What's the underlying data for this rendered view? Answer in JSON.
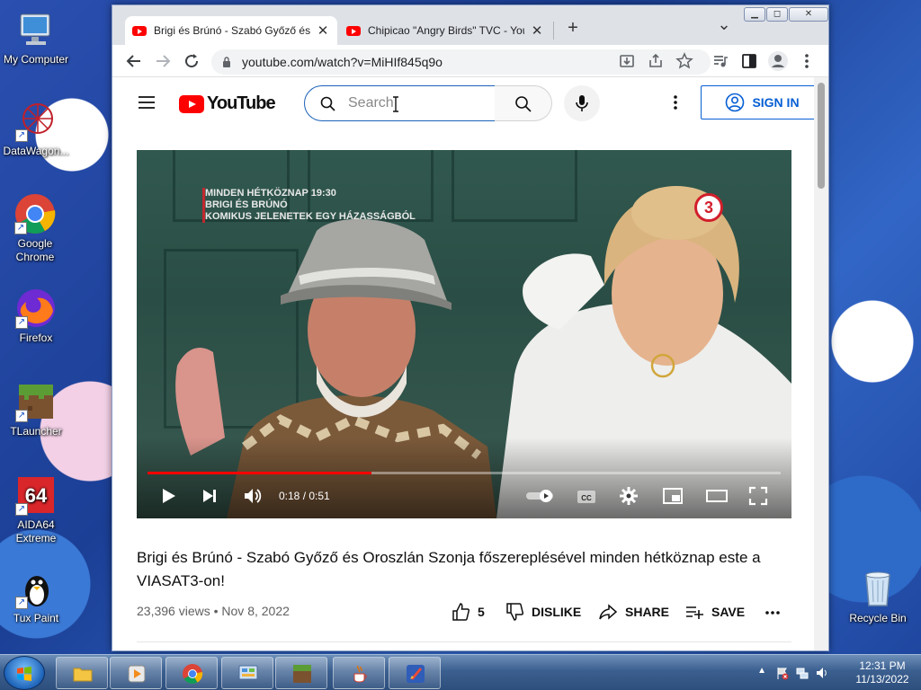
{
  "desktop": {
    "icons": [
      {
        "label": "My Computer"
      },
      {
        "label": "DataWagon..."
      },
      {
        "label": "Google Chrome"
      },
      {
        "label": "Firefox"
      },
      {
        "label": "TLauncher"
      },
      {
        "label": "AIDA64 Extreme"
      },
      {
        "label": "Tux Paint"
      },
      {
        "label": "Recycle Bin"
      }
    ]
  },
  "browser": {
    "tabs": [
      {
        "title": "Brigi és Brúnó - Szabó Győző és",
        "active": true
      },
      {
        "title": "Chipicao \"Angry Birds\" TVC - You",
        "active": false
      }
    ],
    "new_tab": "+",
    "tab_list": "⌄",
    "url": "youtube.com/watch?v=MiHIf845q9o"
  },
  "youtube": {
    "logo_text": "YouTube",
    "search_placeholder": "Search",
    "sign_in_label": "SIGN IN",
    "player": {
      "overlay_line1": "MINDEN HÉTKÖZNAP 19:30",
      "overlay_line2": "BRIGI ÉS BRÚNÓ",
      "overlay_line3": "KOMIKUS JELENETEK EGY HÁZASSÁGBÓL",
      "channel_badge": "3",
      "time": "0:18 / 0:51",
      "progress_fraction": 0.353
    },
    "video": {
      "title": "Brigi és Brúnó - Szabó Győző és Oroszlán Szonja főszereplésével minden hétköznap este a VIASAT3-on!",
      "views": "23,396 views",
      "separator": "•",
      "date": "Nov 8, 2022",
      "likes": "5",
      "dislike_label": "DISLIKE",
      "share_label": "SHARE",
      "save_label": "SAVE"
    }
  },
  "taskbar": {
    "clock_time": "12:31 PM",
    "clock_date": "11/13/2022"
  },
  "colors": {
    "youtube_red": "#ff0000",
    "link_blue": "#065fd4",
    "search_border": "#1c62b9"
  }
}
